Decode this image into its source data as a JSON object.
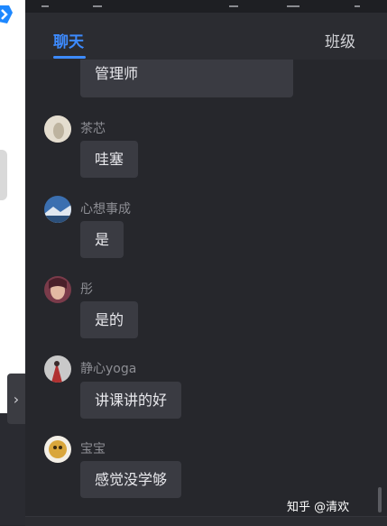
{
  "tabs": {
    "chat": "聊天",
    "class": "班级"
  },
  "previous_message_tail": "管理师",
  "messages": [
    {
      "name": "茶芯",
      "text": "哇塞"
    },
    {
      "name": "心想事成",
      "text": "是"
    },
    {
      "name": "彤",
      "text": "是的"
    },
    {
      "name": "静心yoga",
      "text": "讲课讲的好"
    },
    {
      "name": "宝宝",
      "text": "感觉没学够"
    }
  ],
  "watermark": "知乎 @清欢",
  "colors": {
    "accent": "#3d8bff",
    "panel": "#26272c",
    "bubble": "#3a3b42"
  }
}
